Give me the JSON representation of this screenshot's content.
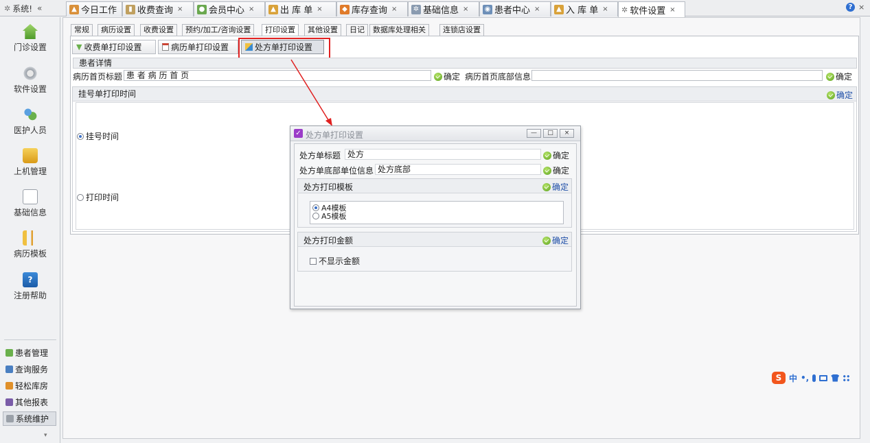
{
  "top_bar": {
    "system_label": "系统!",
    "collapse_symbol": "«",
    "tabs": [
      {
        "label": "今日工作",
        "icon": "calendar-icon",
        "closable": false
      },
      {
        "label": "收费查询",
        "icon": "chart-icon",
        "closable": true
      },
      {
        "label": "会员中心",
        "icon": "members-icon",
        "closable": true
      },
      {
        "label": "出 库 单",
        "icon": "stock-out-icon",
        "closable": true
      },
      {
        "label": "库存查询",
        "icon": "stock-query-icon",
        "closable": true
      },
      {
        "label": "基础信息",
        "icon": "basic-info-icon",
        "closable": true
      },
      {
        "label": "患者中心",
        "icon": "patient-center-icon",
        "closable": true
      },
      {
        "label": "入 库 单",
        "icon": "stock-in-icon",
        "closable": true
      },
      {
        "label": "软件设置",
        "icon": "gear-icon",
        "closable": true,
        "active": true
      }
    ],
    "close_symbol": "×",
    "help_icon": "help-icon"
  },
  "sidebar": {
    "items": [
      {
        "label": "门诊设置",
        "icon": "clinic-house-icon"
      },
      {
        "label": "软件设置",
        "icon": "gears-icon"
      },
      {
        "label": "医护人员",
        "icon": "staff-icon"
      },
      {
        "label": "上机管理",
        "icon": "lock-icon"
      },
      {
        "label": "基础信息",
        "icon": "basic-gears-icon"
      },
      {
        "label": "病历模板",
        "icon": "tree-template-icon"
      },
      {
        "label": "注册帮助",
        "icon": "help-book-icon"
      }
    ],
    "bottom_items": [
      {
        "label": "患者管理",
        "icon": "patients-icon"
      },
      {
        "label": "查询服务",
        "icon": "query-icon"
      },
      {
        "label": "轻松库房",
        "icon": "warehouse-icon"
      },
      {
        "label": "其他报表",
        "icon": "report-icon"
      },
      {
        "label": "系统维护",
        "icon": "maintenance-icon",
        "selected": true
      }
    ],
    "expand_symbol": "▾"
  },
  "settings_tabs": [
    "常规",
    "病历设置",
    "收费设置",
    "预约/加工/咨询设置",
    "打印设置",
    "其他设置",
    "日记",
    "数据库处理相关",
    "连锁店设置"
  ],
  "active_settings_tab": "打印设置",
  "print_subtabs": [
    {
      "label": "收费单打印设置",
      "icon": "receipt-print-icon"
    },
    {
      "label": "病历单打印设置",
      "icon": "record-print-icon"
    },
    {
      "label": "处方单打印设置",
      "icon": "prescription-print-icon",
      "active": true
    }
  ],
  "patient_details": {
    "header": "患者详情",
    "title_label": "病历首页标题",
    "title_value": "患 者 病 历 首 页",
    "confirm": "确定",
    "footer_label": "病历首页底部信息",
    "footer_value": "",
    "footer_confirm": "确定"
  },
  "registration_print_time": {
    "header": "挂号单打印时间",
    "confirm": "确定",
    "options": [
      {
        "label": "挂号时间",
        "selected": true
      },
      {
        "label": "打印时间",
        "selected": false
      }
    ]
  },
  "dialog": {
    "title": "处方单打印设置",
    "controls": [
      "—",
      "□",
      "×"
    ],
    "title_field_label": "处方单标题",
    "title_field_value": "处方",
    "title_confirm": "确定",
    "footer_field_label": "处方单底部单位信息",
    "footer_field_value": "处方底部",
    "footer_confirm": "确定",
    "template_group": {
      "header": "处方打印模板",
      "confirm": "确定",
      "options": [
        {
          "label": "A4模板",
          "selected": true
        },
        {
          "label": "A5模板",
          "selected": false
        }
      ]
    },
    "amount_group": {
      "header": "处方打印金额",
      "confirm": "确定",
      "checkbox_label": "不显示金额",
      "checked": false
    }
  },
  "ime_bar": {
    "logo": "S",
    "mode": "中",
    "punct": "•,"
  },
  "colors": {
    "highlight_red": "#e02020",
    "accent_blue": "#3a6fc7",
    "confirm_green": "#5aa01c"
  }
}
